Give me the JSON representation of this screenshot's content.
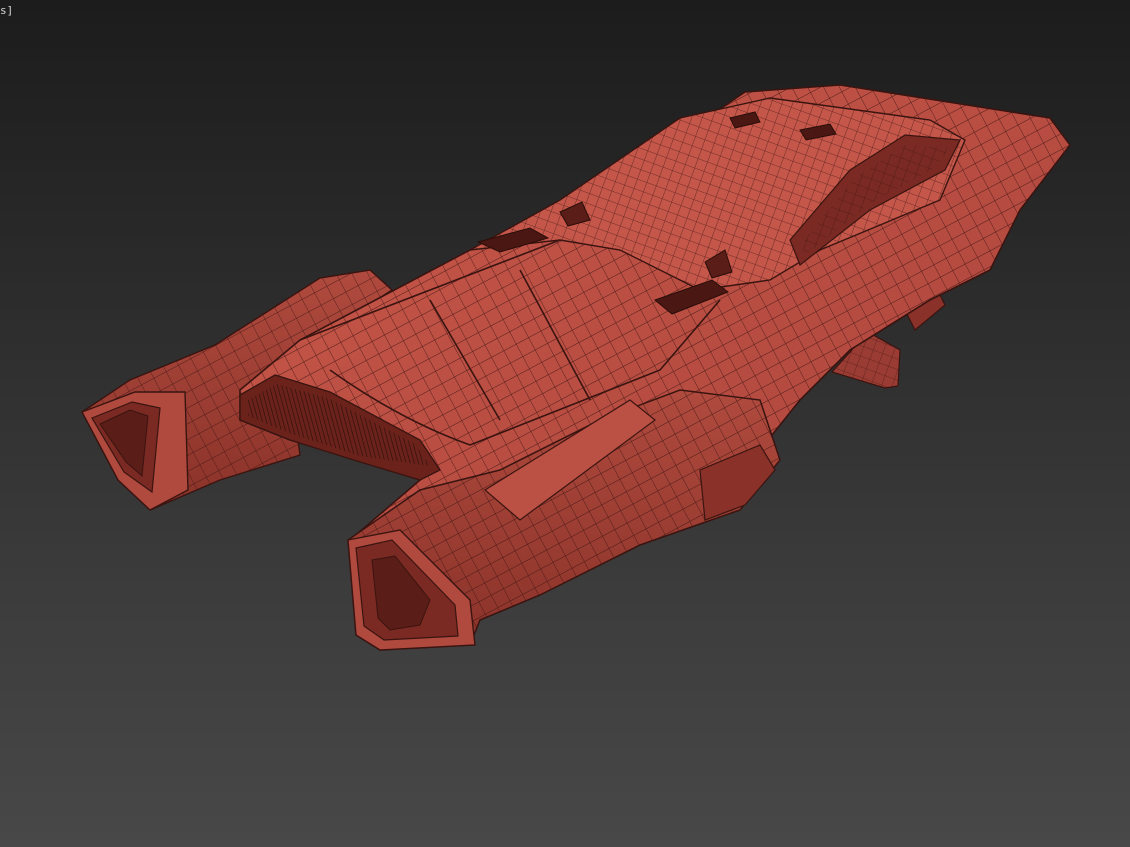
{
  "viewport": {
    "label": "s]",
    "background_top": "#1c1c1c",
    "background_bottom": "#484848"
  },
  "model": {
    "shading": "wireframe-on-shaded",
    "base_color": "#b84a3f",
    "highlight_color": "#cc5a4c",
    "shadow_color": "#7a2a22",
    "wire_color": "#3a1410"
  }
}
